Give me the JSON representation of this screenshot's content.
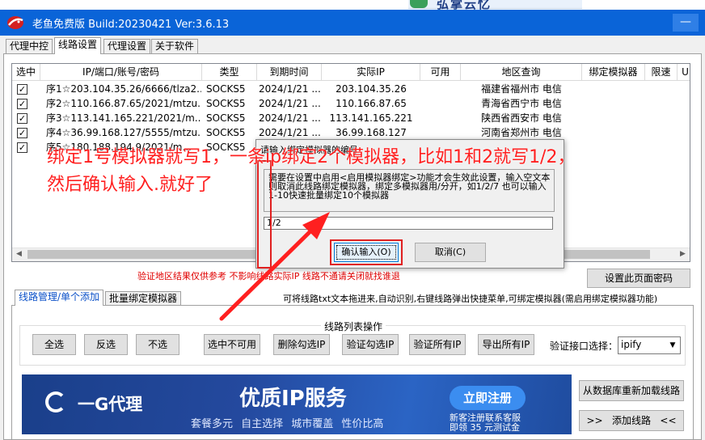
{
  "window": {
    "title": "老鱼免费版 Build:20230421 Ver:3.6.13",
    "minimize_glyph": "—",
    "banner_fragment": "弘掌云忆"
  },
  "tabs": [
    "代理中控",
    "线路设置",
    "代理设置",
    "关于软件"
  ],
  "active_tab": "线路设置",
  "grid": {
    "columns": [
      "选中",
      "IP/端口/账号/密码",
      "类型",
      "到期时间",
      "实际IP",
      "可用",
      "地区查询",
      "绑定模拟器",
      "限速",
      "U"
    ],
    "rows": [
      {
        "checked": true,
        "line": "序1☆203.104.35.26/6666/tlza2...",
        "type": "SOCKS5",
        "expire": "2024/1/21 ...",
        "real_ip": "203.104.35.26",
        "avail": "",
        "region": "福建省福州市  电信",
        "bind": "",
        "limit": ""
      },
      {
        "checked": true,
        "line": "序2☆110.166.87.65/2021/mtzu...",
        "type": "SOCKS5",
        "expire": "2024/1/21 ...",
        "real_ip": "110.166.87.65",
        "avail": "",
        "region": "青海省西宁市  电信",
        "bind": "",
        "limit": ""
      },
      {
        "checked": true,
        "line": "序3☆113.141.165.221/2021/m...",
        "type": "SOCKS5",
        "expire": "2024/1/21 ...",
        "real_ip": "113.141.165.221",
        "avail": "",
        "region": "陕西省西安市  电信",
        "bind": "",
        "limit": ""
      },
      {
        "checked": true,
        "line": "序4☆36.99.168.127/5555/mtzu...",
        "type": "SOCKS5",
        "expire": "2024/1/21 ...",
        "real_ip": "36.99.168.127",
        "avail": "",
        "region": "河南省郑州市  电信",
        "bind": "",
        "limit": ""
      },
      {
        "checked": true,
        "line": "序5☆180.188.194.9/2021/m...",
        "type": "SOCKS5",
        "expire": "",
        "real_ip": "",
        "avail": "",
        "region": "",
        "bind": "",
        "limit": ""
      }
    ]
  },
  "region_notice": "验证地区结果仅供参考 不影响线路实际IP 线路不通请关闭就找谁退",
  "page_password_button": "设置此页面密码",
  "subtabs": [
    "线路管理/单个添加",
    "批量绑定模拟器"
  ],
  "drag_hint": "可将线路txt文本拖进来,自动识别,右键线路弹出快捷菜单,可绑定模拟器(需启用绑定模拟器功能)",
  "line_ops": {
    "group_label": "线路列表操作",
    "buttons": [
      "全选",
      "反选",
      "不选",
      "选中不可用",
      "删除勾选IP",
      "验证勾选IP",
      "验证所有IP",
      "导出所有IP"
    ],
    "verify_label": "验证接口选择：",
    "verify_value": "ipify"
  },
  "reload_button": "从数据库重新加载线路",
  "add_line_button": ">>   添加线路   <<",
  "ad": {
    "logo": "一G代理",
    "headline": "优质IP服务",
    "subline": "套餐多元 自主选择 城市覆盖 性价比高",
    "register": "立即注册",
    "note_line1": "新客注册联系客服",
    "note_line2": "即领 35 元测试金"
  },
  "dialog": {
    "title": "请输入绑定模拟器的编号",
    "message": "需要在设置中启用<启用模拟器绑定>功能才会生效此设置，输入空文本则取消此线路绑定模拟器，绑定多模拟器用/分开，如1/2/7 也可以输入1-10快速批量绑定10个模拟器",
    "input_value": "1/2",
    "ok": "确认输入(O)",
    "cancel": "取消(C)"
  },
  "annotation": {
    "line1": "绑定1号模拟器就写1，一条ip绑定2个模拟器，比如1和2就写1/2，",
    "line2": "然后确认输入.就好了",
    "color": "#ff2020"
  },
  "colors": {
    "titlebar": "#0a64d8",
    "accent": "#0078d7",
    "notice": "#e00000"
  }
}
